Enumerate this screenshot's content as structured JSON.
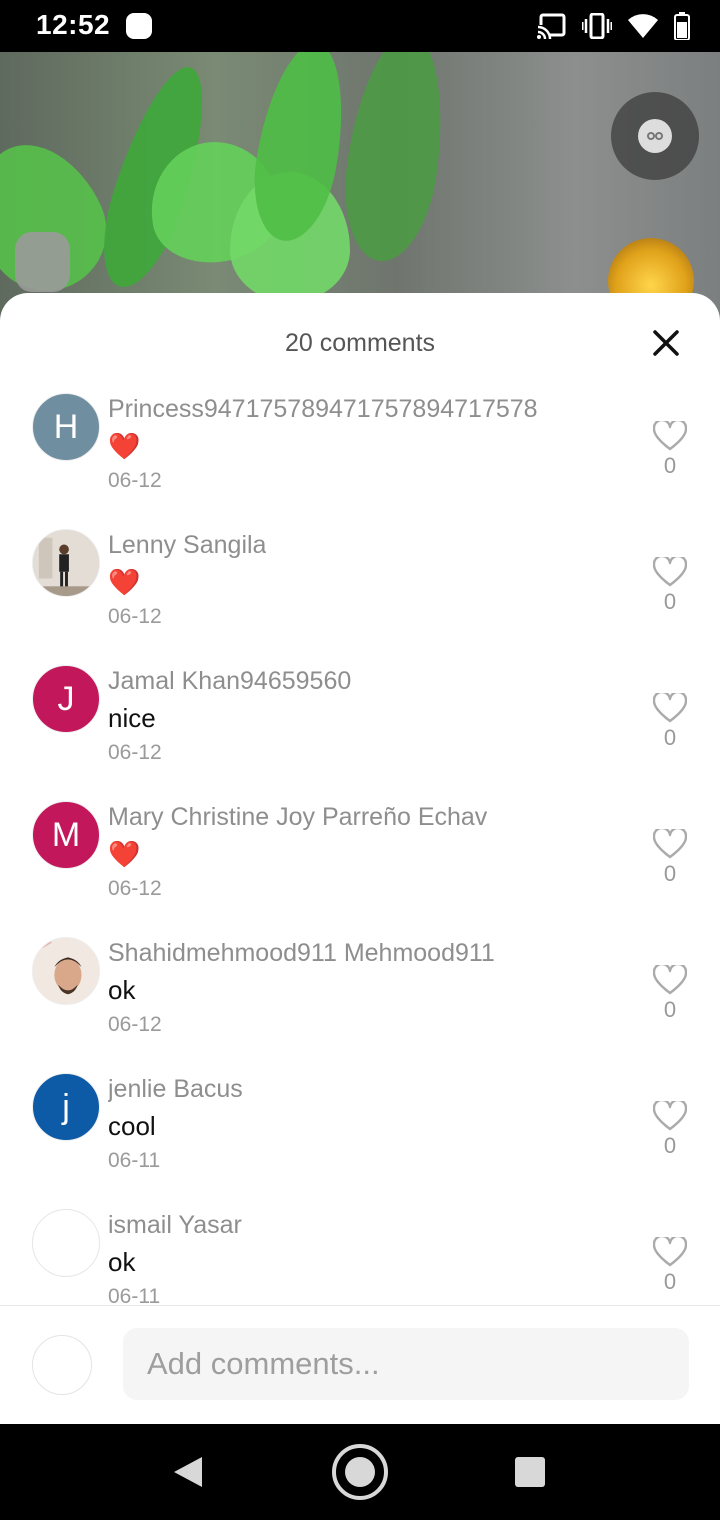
{
  "status_bar": {
    "time": "12:52",
    "icons": [
      "cast-icon",
      "vibrate-icon",
      "wifi-icon",
      "battery-icon"
    ]
  },
  "video": {
    "controls": [
      "camera-switch-icon",
      "gift-icon"
    ]
  },
  "sheet": {
    "title": "20 comments",
    "close_icon": "close-icon"
  },
  "comments": [
    {
      "name": "Princess94717578947175789471757​8",
      "text": "❤️",
      "date": "06-12",
      "likes": "0",
      "avatar_letter": "H",
      "avatar_color": "#6f8fa0"
    },
    {
      "name": "Lenny Sangila",
      "text": "❤️",
      "date": "06-12",
      "likes": "0",
      "avatar_letter": "",
      "avatar_color": "#d9d3cc"
    },
    {
      "name": "Jamal Khan94659560",
      "text": "nice",
      "date": "06-12",
      "likes": "0",
      "avatar_letter": "J",
      "avatar_color": "#c2185b"
    },
    {
      "name": "Mary Christine Joy Parreño Echav",
      "text": "❤️",
      "date": "06-12",
      "likes": "0",
      "avatar_letter": "M",
      "avatar_color": "#c2185b"
    },
    {
      "name": "Shahidmehmood911 Mehmood911",
      "text": "ok",
      "date": "06-12",
      "likes": "0",
      "avatar_letter": "",
      "avatar_color": "#e9ded6"
    },
    {
      "name": "jenlie Bacus",
      "text": "cool",
      "date": "06-11",
      "likes": "0",
      "avatar_letter": "j",
      "avatar_color": "#0d5aa7"
    },
    {
      "name": "ismail Yasar",
      "text": "ok",
      "date": "06-11",
      "likes": "0",
      "avatar_letter": "",
      "avatar_color": "#ffffff"
    }
  ],
  "composer": {
    "placeholder": "Add comments..."
  },
  "nav": {
    "icons": [
      "back-icon",
      "home-icon",
      "recents-icon"
    ]
  }
}
